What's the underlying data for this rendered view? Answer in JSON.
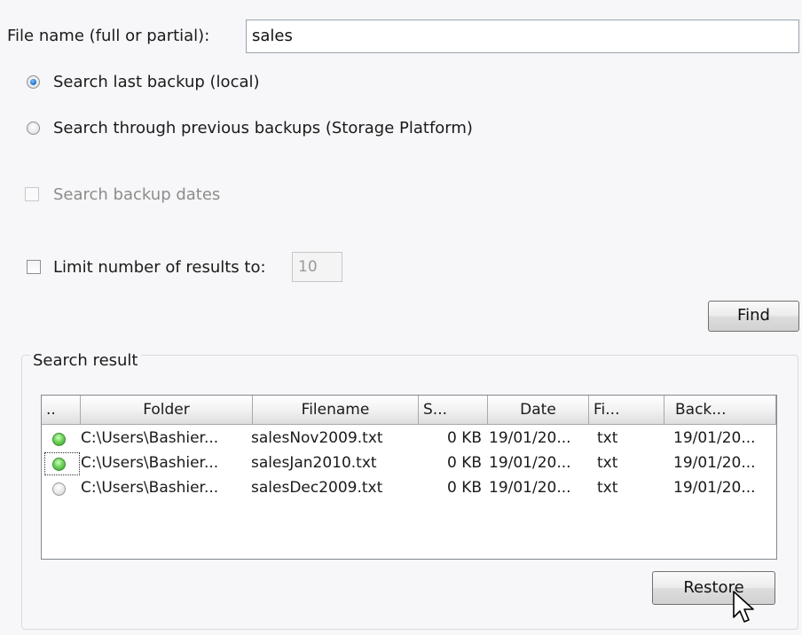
{
  "filename_field": {
    "label": "File name (full or partial):",
    "value": "sales"
  },
  "search_options": {
    "last_backup_label": "Search last backup (local)",
    "previous_backups_label": "Search through previous backups (Storage Platform)",
    "selected": "last_backup"
  },
  "backup_dates": {
    "label": "Search backup dates",
    "enabled": false
  },
  "limit_results": {
    "label": "Limit number of results to:",
    "value": "10",
    "checked": false
  },
  "find_button": {
    "label": "Find"
  },
  "results": {
    "group_title": "Search result",
    "columns": [
      "..",
      "Folder",
      "Filename",
      "S...",
      "Date",
      "Fi...",
      "Back..."
    ],
    "rows": [
      {
        "status": "available",
        "folder": "C:\\Users\\Bashier...",
        "filename": "salesNov2009.txt",
        "size": "0 KB",
        "date": "19/01/20...",
        "type": "txt",
        "backup": "19/01/20..."
      },
      {
        "status": "available",
        "folder": "C:\\Users\\Bashier...",
        "filename": "salesJan2010.txt",
        "size": "0 KB",
        "date": "19/01/20...",
        "type": "txt",
        "backup": "19/01/20..."
      },
      {
        "status": "unavailable",
        "folder": "C:\\Users\\Bashier...",
        "filename": "salesDec2009.txt",
        "size": "0 KB",
        "date": "19/01/20...",
        "type": "txt",
        "backup": "19/01/20..."
      }
    ]
  },
  "restore_button": {
    "label": "Restore"
  },
  "colors": {
    "window_bg": "#f7f7f9",
    "radio_dot": "#1e78d6",
    "status_on": "#2f9a24",
    "status_off": "#bdbdbd"
  }
}
